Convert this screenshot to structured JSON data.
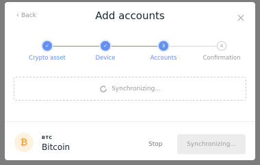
{
  "header": {
    "back_label": "Back",
    "title": "Add accounts"
  },
  "stepper": {
    "steps": [
      {
        "label": "Crypto asset",
        "status": "done",
        "marker": "✓"
      },
      {
        "label": "Device",
        "status": "done",
        "marker": "✓"
      },
      {
        "label": "Accounts",
        "status": "active",
        "marker": "3"
      },
      {
        "label": "Confirmation",
        "status": "todo",
        "marker": "4"
      }
    ]
  },
  "sync": {
    "status_text": "Synchronizing..."
  },
  "footer": {
    "currency_ticker": "BTC",
    "currency_name": "Bitcoin",
    "currency_symbol": "₿",
    "stop_label": "Stop",
    "primary_label": "Synchronizing..."
  },
  "colors": {
    "accent": "#6490f1",
    "bitcoin": "#f7a531",
    "overlay": "#7d7d7d"
  }
}
